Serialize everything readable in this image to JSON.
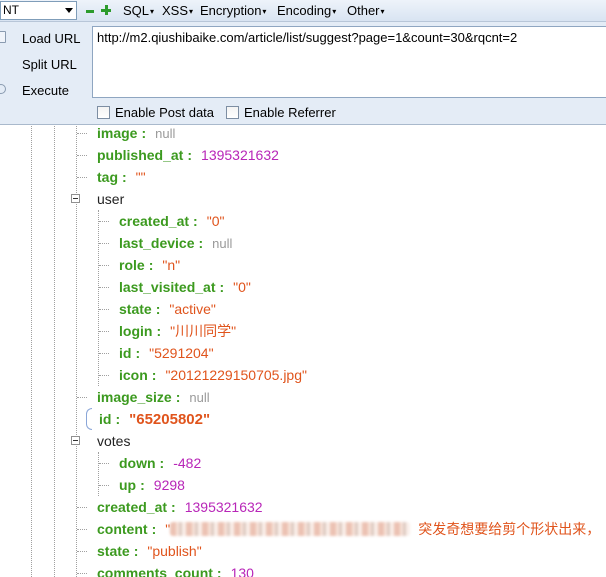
{
  "toolbar": {
    "combo_value": "NT",
    "menus": [
      "SQL",
      "XSS",
      "Encryption",
      "Encoding",
      "Other"
    ]
  },
  "hackbar": {
    "load_url": "Load URL",
    "split_url": "Split URL",
    "execute": "Execute",
    "url": "http://m2.qiushibaike.com/article/list/suggest?page=1&count=30&rqcnt=2",
    "enable_post": "Enable Post data",
    "enable_referrer": "Enable Referrer"
  },
  "tree": {
    "image": {
      "key": "image",
      "value": "null"
    },
    "published_at": {
      "key": "published_at",
      "value": "1395321632"
    },
    "tag": {
      "key": "tag",
      "value": "\"\""
    },
    "user": {
      "label": "user",
      "created_at": {
        "key": "created_at",
        "value": "\"0\""
      },
      "last_device": {
        "key": "last_device",
        "value": "null"
      },
      "role": {
        "key": "role",
        "value": "\"n\""
      },
      "last_visited_at": {
        "key": "last_visited_at",
        "value": "\"0\""
      },
      "state": {
        "key": "state",
        "value": "\"active\""
      },
      "login": {
        "key": "login",
        "value": "\"川川同学\""
      },
      "id": {
        "key": "id",
        "value": "\"5291204\""
      },
      "icon": {
        "key": "icon",
        "value": "\"20121229150705.jpg\""
      }
    },
    "image_size": {
      "key": "image_size",
      "value": "null"
    },
    "id": {
      "key": "id",
      "value": "\"65205802\""
    },
    "votes": {
      "label": "votes",
      "down": {
        "key": "down",
        "value": "-482"
      },
      "up": {
        "key": "up",
        "value": "9298"
      }
    },
    "created_at": {
      "key": "created_at",
      "value": "1395321632"
    },
    "content": {
      "key": "content",
      "value_prefix": "\"",
      "value_visible": "突发奇想要给剪个形状出来，"
    },
    "state": {
      "key": "state",
      "value": "\"publish\""
    },
    "comments_count": {
      "key": "comments_count",
      "value": "130"
    }
  },
  "colors": {
    "key": "#3c9a1f",
    "string": "#e0541c",
    "number": "#b826b8",
    "null": "#9a9a9a",
    "panel_bg": "#e4ecf6"
  }
}
